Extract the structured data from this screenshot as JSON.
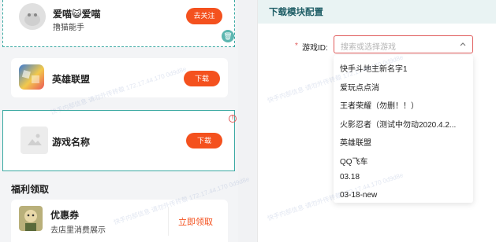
{
  "follow_card": {
    "user_name": "爱喵😺爱喵",
    "user_desc": "撸猫能手",
    "unfollow_label": "去关注"
  },
  "game_card": {
    "name": "英雄联盟",
    "download_label": "下载"
  },
  "placeholder_card": {
    "name": "游戏名称",
    "download_label": "下载"
  },
  "welfare": {
    "section_title": "福利领取",
    "coupon_title": "优惠券",
    "coupon_desc": "去店里消费展示",
    "claim_label": "立即领取"
  },
  "config_panel": {
    "title": "下载模块配置",
    "required_mark": "*",
    "game_id_label": "游戏ID:",
    "game_search_placeholder": "搜索或选择游戏",
    "dropdown_options": [
      "快手斗地主新名字1",
      "爱玩点点消",
      "王者荣耀（勿删！！）",
      "火影忍者（测试中勿动2020.4.2...",
      "英雄联盟",
      "QQ飞车",
      "03.18",
      "03-18-new"
    ]
  },
  "watermark_text": "快手内部信息 请勿外传转载 172.17.44.170 0d9d8e",
  "colors": {
    "accent_orange": "#f4511e",
    "teal_border": "#3aa9a2",
    "panel_header_bg": "#e9f3f3",
    "panel_title": "#1f5e66",
    "select_border": "#e05a5a"
  }
}
